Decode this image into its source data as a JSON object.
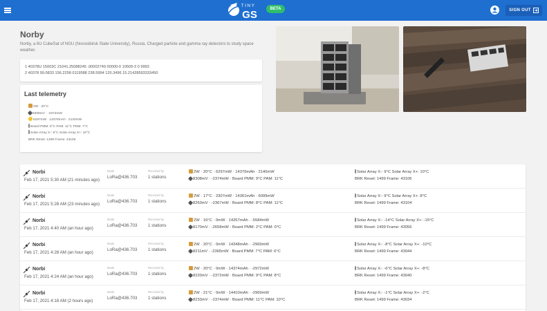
{
  "header": {
    "logo_top": "TINY",
    "logo_main": "GS",
    "beta": "BETA",
    "sign_out": "SIGN OUT"
  },
  "satellite": {
    "name": "Norby",
    "description": "Norby, a 6U CubeSat of NGU (Novosibirsk State University), Russia. Charged particle and gamma ray detectors to study space weather.",
    "tle_line1": "1 40378U 15003C 21041.25088245 .00002749 00000-0 10509-3 0 9993",
    "tle_line2": "2 40378 99.0833 156.2258 0119588 238.5994 120.3496 15.21428593333450"
  },
  "telemetry": {
    "title": "Last telemetry",
    "lines": [
      "2W · 20°C",
      "8308mV · -2374mW",
      "6297mW · 14376mAh · 2140mW",
      "Board PMM: 9°C PAM: 11°C PDM: 7°C",
      "Solar Array X-: 9°C Solar Array X+: 10°C",
      "BRK Reset: 1499 Frame: 43106"
    ]
  },
  "packets": {
    "mode_label": "Mode",
    "received_label": "Received by",
    "rows": [
      {
        "name": "Norbi",
        "date": "Feb 17, 2021 5:30 AM (21 minutes ago)",
        "mode": "LoRa@436.703",
        "received": "1 stations",
        "t1": "2W · 20°C · 6297mW · 14376mAh · 2140mW",
        "t2": "8308mV · -2374mW · Board PMM: 9°C PAM: 11°C",
        "e1": "Solar Array X-: 9°C Solar Array X+: 10°C",
        "e2": "BRK Reset: 1499 Frame: 43106"
      },
      {
        "name": "Norbi",
        "date": "Feb 17, 2021 5:28 AM (23 minutes ago)",
        "mode": "LoRa@436.703",
        "received": "1 stations",
        "t1": "2W · 17°C · 2307mW · 14361mAh · 6099mW",
        "t2": "8263mV · -2367mW · Board PMM: 8°C PAM: 11°C",
        "e1": "Solar Array X-: 9°C Solar Array X+: 8°C",
        "e2": "BRK Reset: 1499 Frame: 43104"
      },
      {
        "name": "Norbi",
        "date": "Feb 17, 2021 4:40 AM (an hour ago)",
        "mode": "LoRa@436.703",
        "received": "1 stations",
        "t1": "2W · 16°C · 0mW · 14267mAh · -5584mW",
        "t2": "8170mV · -2658mW · Board PMM: 2°C PAM: 0°C",
        "e1": "Solar Array X-: -14°C Solar Array X+: -15°C",
        "e2": "BRK Reset: 1499 Frame: 43056"
      },
      {
        "name": "Norbi",
        "date": "Feb 17, 2021 4:28 AM (an hour ago)",
        "mode": "LoRa@436.703",
        "received": "1 stations",
        "t1": "2W · 20°C · 0mW · 14348mAh · -2969mW",
        "t2": "8211mV · -2365mW · Board PMM: 7°C PAM: 6°C",
        "e1": "Solar Array X-: -8°C Solar Array X+: -10°C",
        "e2": "BRK Reset: 1499 Frame: 43044"
      },
      {
        "name": "Norbi",
        "date": "Feb 17, 2021 4:24 AM (an hour ago)",
        "mode": "LoRa@436.703",
        "received": "1 stations",
        "t1": "2W · 20°C · 0mW · 14374mAh · -2972mW",
        "t2": "8220mV · -2372mW · Board PMM: 9°C PAM: 8°C",
        "e1": "Solar Array X-: -6°C Solar Array X+: -8°C",
        "e2": "BRK Reset: 1499 Frame: 43040"
      },
      {
        "name": "Norbi",
        "date": "Feb 17, 2021 4:18 AM (2 hours ago)",
        "mode": "LoRa@436.703",
        "received": "1 stations",
        "t1": "2W · 21°C · 0mW · 14410mAh · -2969mW",
        "t2": "8233mV · -2374mW · Board PMM: 11°C PAM: 10°C",
        "e1": "Solar Array X-: -1°C Solar Array X+: -2°C",
        "e2": "BRK Reset: 1499 Frame: 43034"
      }
    ]
  },
  "colors": {
    "topbar": "#1e6fd0",
    "beta": "#2fbe6b",
    "background": "#f2f2f2"
  }
}
